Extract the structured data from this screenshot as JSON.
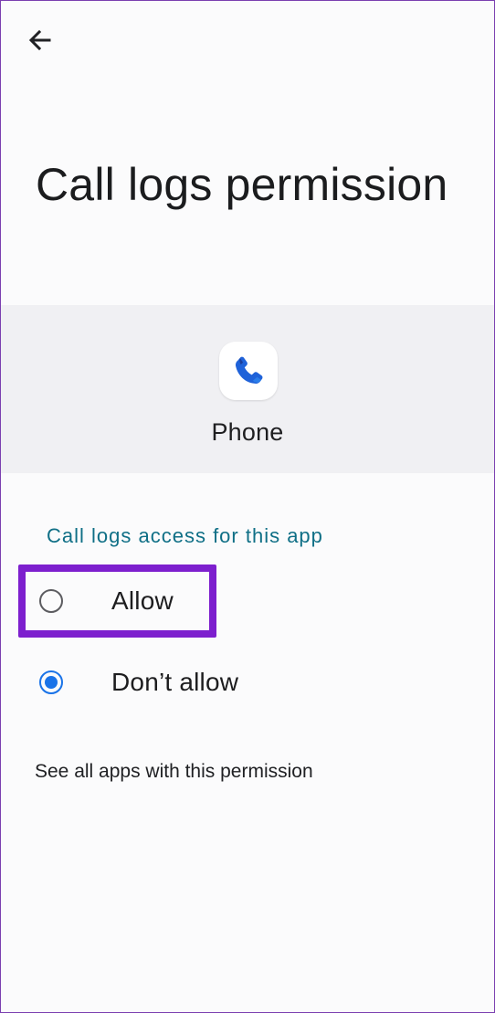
{
  "page": {
    "title": "Call logs permission"
  },
  "app": {
    "name": "Phone",
    "icon": "phone-icon"
  },
  "section": {
    "label": "Call logs access for this app"
  },
  "options": [
    {
      "label": "Allow",
      "selected": false
    },
    {
      "label": "Don’t allow",
      "selected": true
    }
  ],
  "link": {
    "label": "See all apps with this permission"
  },
  "colors": {
    "accent": "#1a73e8",
    "section_label": "#0f6f86",
    "highlight": "#7d1fce"
  },
  "icons": {
    "back": "back-arrow-icon",
    "app": "phone-icon"
  }
}
